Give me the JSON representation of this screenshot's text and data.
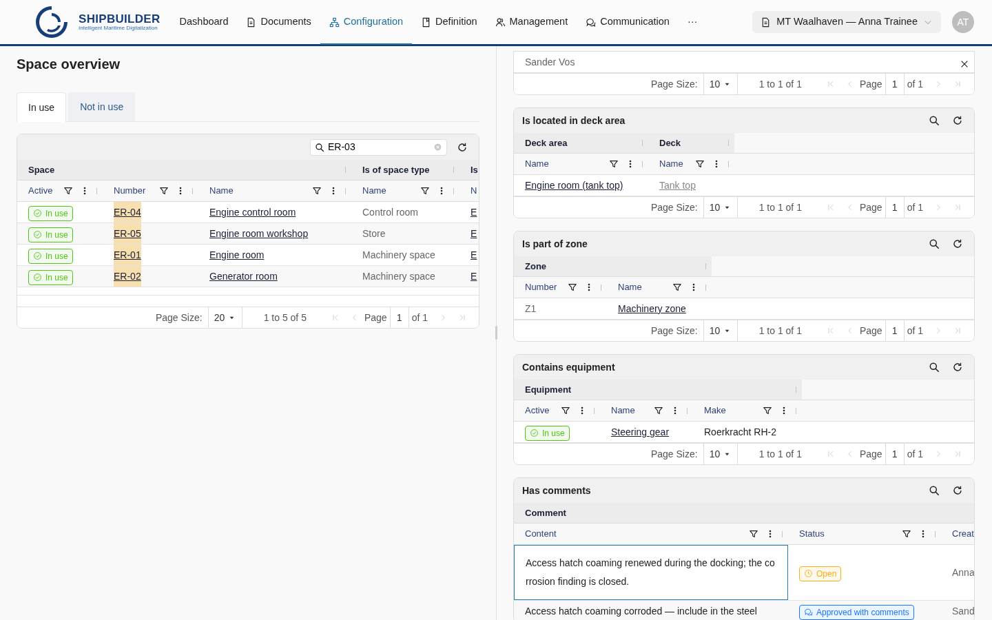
{
  "header": {
    "brand": {
      "name": "SHIPBUILDER",
      "tagline": "Intelligent Maritime Digitalization"
    },
    "nav": [
      {
        "label": "Dashboard",
        "selected": false
      },
      {
        "label": "Documents",
        "selected": false
      },
      {
        "label": "Configuration",
        "selected": true
      },
      {
        "label": "Definition",
        "selected": false
      },
      {
        "label": "Management",
        "selected": false
      },
      {
        "label": "Communication",
        "selected": false
      }
    ],
    "more": "···",
    "project": "MT Waalhaven — Anna Trainee",
    "avatar": "AT"
  },
  "page": {
    "title": "Space overview",
    "tabs": [
      {
        "label": "In use",
        "selected": true
      },
      {
        "label": "Not in use",
        "selected": false
      }
    ],
    "grid": {
      "search": "ER-03",
      "groups": [
        {
          "label": "Space"
        },
        {
          "label": "Is of space type"
        },
        {
          "label": "Is"
        }
      ],
      "columns": [
        "Active",
        "Number",
        "Name",
        "Name",
        "N"
      ],
      "rows": [
        {
          "selected": false,
          "cells": [
            {
              "kind": "ok-status",
              "text": "In use",
              "color": "#52c41a"
            },
            {
              "kind": "link",
              "highlighted": true,
              "text": "ER-04"
            },
            {
              "kind": "link",
              "text": "Engine control room"
            },
            {
              "kind": "muted",
              "text": "Control room"
            },
            {
              "kind": "link",
              "text": "E"
            }
          ]
        },
        {
          "selected": false,
          "cells": [
            {
              "kind": "ok-status",
              "text": "In use",
              "color": "#52c41a"
            },
            {
              "kind": "link",
              "highlighted": true,
              "text": "ER-05"
            },
            {
              "kind": "link",
              "text": "Engine room workshop"
            },
            {
              "kind": "muted",
              "text": "Store"
            },
            {
              "kind": "link",
              "text": "E"
            }
          ]
        },
        {
          "selected": false,
          "cells": [
            {
              "kind": "ok-status",
              "text": "In use",
              "color": "#52c41a"
            },
            {
              "kind": "link",
              "highlighted": true,
              "text": "ER-01"
            },
            {
              "kind": "link",
              "text": "Engine room"
            },
            {
              "kind": "muted",
              "text": "Machinery space"
            },
            {
              "kind": "link",
              "text": "E"
            }
          ]
        },
        {
          "selected": false,
          "cells": [
            {
              "kind": "ok-status",
              "text": "In use",
              "color": "#52c41a"
            },
            {
              "kind": "link",
              "highlighted": true,
              "text": "ER-02"
            },
            {
              "kind": "link",
              "text": "Generator room"
            },
            {
              "kind": "muted",
              "text": "Machinery space"
            },
            {
              "kind": "link",
              "text": "E"
            }
          ]
        }
      ],
      "footer": {
        "page_size_label": "Page Size:",
        "page_size": "20",
        "range": "1 to 5 of 5",
        "page_label": "Page",
        "page": "1",
        "page_count": "of 1"
      }
    }
  },
  "panels": [
    {
      "rows": [
        {
          "selected": false,
          "dismissible": true,
          "cells": [
            {
              "kind": "muted",
              "text": "Sander Vos"
            }
          ]
        }
      ],
      "footer": {
        "page_size_label": "Page Size:",
        "page_size": "10",
        "range": "1 to 1 of 1",
        "page_label": "Page",
        "page": "1",
        "page_count": "of 1"
      }
    },
    {
      "title": "Is located in deck area",
      "groups": [
        {
          "label": "Deck area"
        },
        {
          "label": "Deck"
        }
      ],
      "columns": [
        "Name",
        "Name"
      ],
      "rows": [
        {
          "selected": false,
          "cells": [
            {
              "kind": "link",
              "text": "Engine room (tank top)"
            },
            {
              "kind": "faded-link",
              "text": "Tank top"
            }
          ]
        }
      ],
      "footer": {
        "page_size_label": "Page Size:",
        "page_size": "10",
        "range": "1 to 1 of 1",
        "page_label": "Page",
        "page": "1",
        "page_count": "of 1"
      }
    },
    {
      "title": "Is part of zone",
      "groups": [
        {
          "label": "Zone"
        }
      ],
      "columns": [
        "Number",
        "Name"
      ],
      "rows": [
        {
          "selected": false,
          "cells": [
            {
              "kind": "muted",
              "text": "Z1"
            },
            {
              "kind": "link",
              "text": "Machinery zone"
            }
          ]
        }
      ],
      "footer": {
        "page_size_label": "Page Size:",
        "page_size": "10",
        "range": "1 to 1 of 1",
        "page_label": "Page",
        "page": "1",
        "page_count": "of 1"
      }
    },
    {
      "title": "Contains equipment",
      "groups": [
        {
          "label": "Equipment"
        }
      ],
      "columns": [
        "Active",
        "Name",
        "Make"
      ],
      "rows": [
        {
          "selected": false,
          "cells": [
            {
              "kind": "ok-status",
              "text": "In use",
              "color": "#52c41a"
            },
            {
              "kind": "link",
              "text": "Steering gear"
            },
            {
              "kind": "text",
              "text": "Roerkracht RH-2"
            }
          ]
        }
      ],
      "footer": {
        "page_size_label": "Page Size:",
        "page_size": "10",
        "range": "1 to 1 of 1",
        "page_label": "Page",
        "page": "1",
        "page_count": "of 1"
      }
    },
    {
      "title": "Has comments",
      "groups": [
        {
          "label": "Comment"
        }
      ],
      "columns": [
        "Content",
        "Status",
        "Creat"
      ],
      "rows": [
        {
          "selected": true,
          "cells": [
            {
              "kind": "text",
              "text": "Access hatch coaming renewed during the docking; the corrosion finding is closed."
            },
            {
              "kind": "open-status",
              "text": "Open",
              "color": "#faad14"
            },
            {
              "kind": "muted",
              "text": "Anna"
            }
          ]
        },
        {
          "selected": false,
          "cells": [
            {
              "kind": "text",
              "text": "Access hatch coaming corroded — include in the steel"
            },
            {
              "kind": "comment-status",
              "text": "Approved with comments",
              "color": "#1677ff"
            },
            {
              "kind": "muted",
              "text": "Sand"
            }
          ]
        }
      ]
    }
  ]
}
